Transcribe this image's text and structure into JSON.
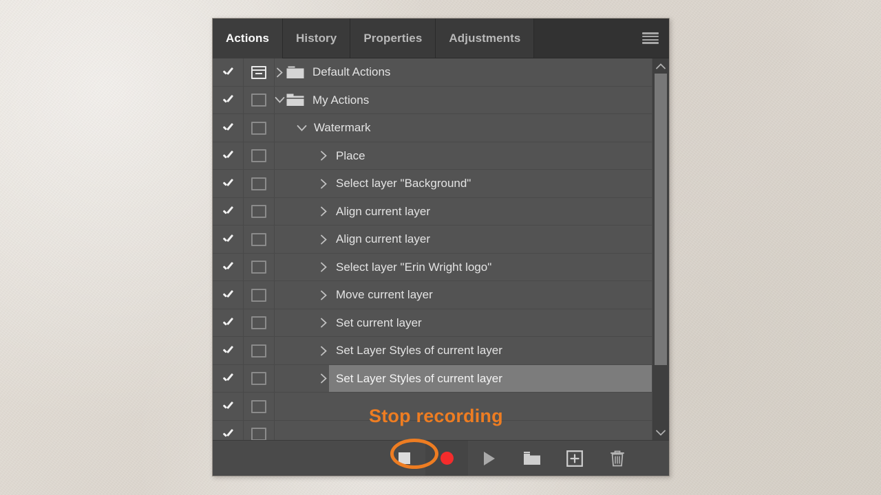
{
  "panel": {
    "tabs": [
      {
        "label": "Actions",
        "active": true
      },
      {
        "label": "History",
        "active": false
      },
      {
        "label": "Properties",
        "active": false
      },
      {
        "label": "Adjustments",
        "active": false
      }
    ],
    "menu_icon": "hamburger-menu-icon"
  },
  "rows": [
    {
      "label": "Default Actions",
      "checked": true,
      "dialog": "on",
      "indent": 0,
      "twisty": "right",
      "folder": "closed",
      "selected": false
    },
    {
      "label": "My Actions",
      "checked": true,
      "dialog": "off",
      "indent": 0,
      "twisty": "down",
      "folder": "open",
      "selected": false
    },
    {
      "label": "Watermark",
      "checked": true,
      "dialog": "off",
      "indent": 1,
      "twisty": "down",
      "folder": "none",
      "selected": false
    },
    {
      "label": "Place",
      "checked": true,
      "dialog": "off",
      "indent": 2,
      "twisty": "right",
      "folder": "none",
      "selected": false
    },
    {
      "label": "Select layer \"Background\"",
      "checked": true,
      "dialog": "off",
      "indent": 2,
      "twisty": "right",
      "folder": "none",
      "selected": false
    },
    {
      "label": "Align current layer",
      "checked": true,
      "dialog": "off",
      "indent": 2,
      "twisty": "right",
      "folder": "none",
      "selected": false
    },
    {
      "label": "Align current layer",
      "checked": true,
      "dialog": "off",
      "indent": 2,
      "twisty": "right",
      "folder": "none",
      "selected": false
    },
    {
      "label": "Select layer \"Erin Wright logo\"",
      "checked": true,
      "dialog": "off",
      "indent": 2,
      "twisty": "right",
      "folder": "none",
      "selected": false
    },
    {
      "label": "Move current layer",
      "checked": true,
      "dialog": "off",
      "indent": 2,
      "twisty": "right",
      "folder": "none",
      "selected": false
    },
    {
      "label": "Set current layer",
      "checked": true,
      "dialog": "off",
      "indent": 2,
      "twisty": "right",
      "folder": "none",
      "selected": false
    },
    {
      "label": "Set Layer Styles of current layer",
      "checked": true,
      "dialog": "off",
      "indent": 2,
      "twisty": "right",
      "folder": "none",
      "selected": false
    },
    {
      "label": "Set Layer Styles of current layer",
      "checked": true,
      "dialog": "off",
      "indent": 2,
      "twisty": "right",
      "folder": "none",
      "selected": true
    },
    {
      "label": "",
      "checked": true,
      "dialog": "off",
      "indent": 2,
      "twisty": "none",
      "folder": "none",
      "selected": false
    },
    {
      "label": "",
      "checked": true,
      "dialog": "off",
      "indent": 2,
      "twisty": "none",
      "folder": "none",
      "selected": false
    }
  ],
  "scrollbar": {
    "up_icon": "chevron-up-icon",
    "down_icon": "chevron-down-icon"
  },
  "toolbar": {
    "buttons": [
      {
        "name": "stop-playing-recording-button",
        "icon": "stop-icon",
        "tooltip": "Stop playing/recording"
      },
      {
        "name": "begin-recording-button",
        "icon": "record-icon",
        "tooltip": "Begin recording"
      },
      {
        "name": "play-selection-button",
        "icon": "play-icon",
        "tooltip": "Play selection"
      },
      {
        "name": "create-new-set-button",
        "icon": "folder-icon",
        "tooltip": "Create new set"
      },
      {
        "name": "create-new-action-button",
        "icon": "new-action-icon",
        "tooltip": "Create new action"
      },
      {
        "name": "delete-button",
        "icon": "trash-icon",
        "tooltip": "Delete"
      }
    ]
  },
  "annotation": {
    "text": "Stop recording",
    "color": "#ee7d22",
    "highlight_shape": "ellipse"
  },
  "colors": {
    "panel_bg": "#535353",
    "tabbar_bg": "#323232",
    "active_tab_bg": "#3d3d3d",
    "selected_row_bg": "#7c7c7c",
    "toolbar_bg": "#4a4a4a",
    "accent_orange": "#ee7d22",
    "record_red": "#f52c2c",
    "backdrop": "#dfdad3"
  }
}
